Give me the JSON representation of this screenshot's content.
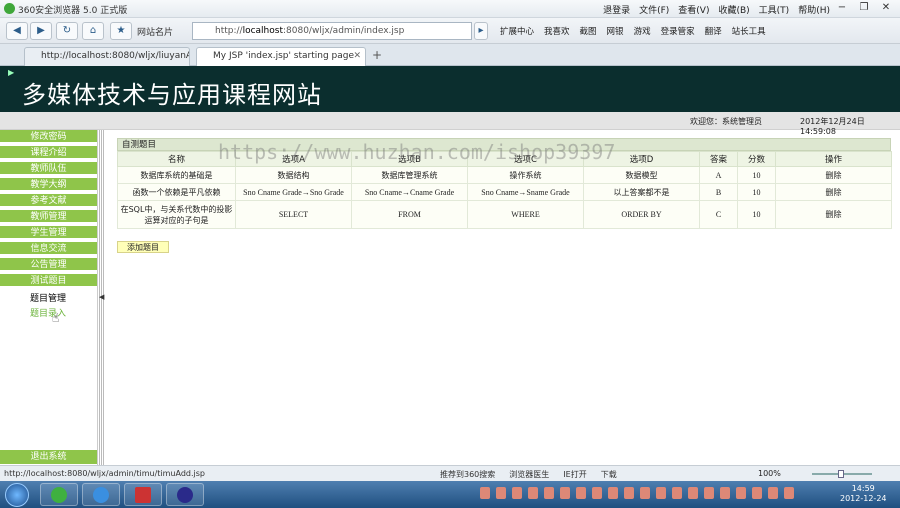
{
  "browser": {
    "window_title": "360安全浏览器 5.0 正式版",
    "title_menu": [
      "退登录",
      "文件(F)",
      "查看(V)",
      "收藏(B)",
      "工具(T)",
      "帮助(H)"
    ],
    "fav_label": "网站名片",
    "url_prefix": "http://",
    "url_host": "localhost",
    "url_rest": ":8080/wljx/admin/index.jsp",
    "addr_tools": [
      "扩展中心",
      "我喜欢",
      "截图",
      "网银",
      "游戏",
      "登录管家",
      "翻译",
      "站长工具"
    ],
    "tabs": [
      {
        "label": "http://localhost:8080/wljx/liuyanAll..."
      },
      {
        "label": "My JSP 'index.jsp' starting page"
      }
    ],
    "new_tab": "+"
  },
  "page": {
    "site_title": "多媒体技术与应用课程网站",
    "welcome": "欢迎您：系统管理员",
    "datetime": "2012年12月24日 14:59:08",
    "watermark": "https://www.huzhan.com/ishop39397"
  },
  "sidebar": {
    "items": [
      {
        "label": "修改密码"
      },
      {
        "label": "课程介绍"
      },
      {
        "label": "教师队伍"
      },
      {
        "label": "教学大纲"
      },
      {
        "label": "参考文献"
      },
      {
        "label": "教师管理"
      },
      {
        "label": "学生管理"
      },
      {
        "label": "信息交流"
      },
      {
        "label": "公告管理"
      },
      {
        "label": "测试题目"
      }
    ],
    "sub_items": [
      {
        "label": "题目管理"
      },
      {
        "label": "题目录入"
      }
    ],
    "logout": "退出系统"
  },
  "main": {
    "section_title": "自测题目",
    "columns": [
      "名称",
      "选项A",
      "选项B",
      "选项C",
      "选项D",
      "答案",
      "分数",
      "操作"
    ],
    "rows": [
      {
        "name": "数据库系统的基础是",
        "a": "数据结构",
        "b": "数据库管理系统",
        "c": "操作系统",
        "d": "数据模型",
        "answer": "A",
        "score": "10",
        "action": "删除"
      },
      {
        "name": "函数一个依赖是平凡依赖",
        "a": "Sno Cname Grade→Sno Grade",
        "b": "Sno Cname→Cname Grade",
        "c": "Sno Cname→Sname Grade",
        "d": "以上答案都不是",
        "answer": "B",
        "score": "10",
        "action": "删除"
      },
      {
        "name": "在SQL中，与关系代数中的投影运算对应的子句是",
        "a": "SELECT",
        "b": "FROM",
        "c": "WHERE",
        "d": "ORDER BY",
        "answer": "C",
        "score": "10",
        "action": "删除"
      }
    ],
    "add_button": "添加题目"
  },
  "statusbar": {
    "url": "http://localhost:8080/wljx/admin/timu/timuAdd.jsp",
    "tools": [
      "推荐到360搜索",
      "浏览器医生",
      "IE打开",
      "下载"
    ],
    "zoom": "100%"
  },
  "taskbar": {
    "time": "14:59",
    "date": "2012-12-24"
  },
  "colors": {
    "banner_bg": "#0b2e2e",
    "menu_green": "#8fc54a"
  }
}
